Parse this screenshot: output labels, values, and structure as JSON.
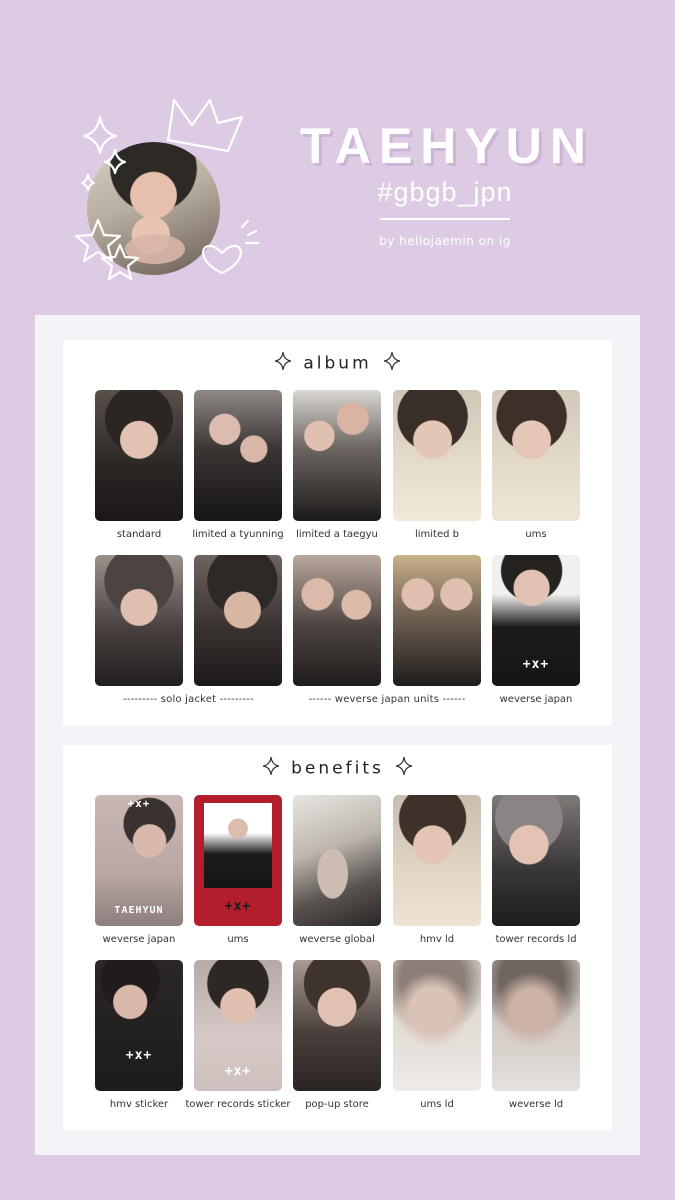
{
  "header": {
    "name": "TAEHYUN",
    "hashtag": "#gbgb_jpn",
    "credit": "by hellojaemin on ig"
  },
  "album": {
    "title": "album",
    "cards": [
      {
        "caption": "standard"
      },
      {
        "caption": "limited a tyunning"
      },
      {
        "caption": "limited a taegyu"
      },
      {
        "caption": "limited b"
      },
      {
        "caption": "ums"
      },
      {
        "caption": ""
      },
      {
        "caption": ""
      },
      {
        "caption": ""
      },
      {
        "caption": ""
      },
      {
        "caption": "weverse japan",
        "logo": "+x+"
      }
    ],
    "group_captions": {
      "solo_jacket": "--------- solo jacket ---------",
      "weverse_units": "------ weverse japan units ------"
    }
  },
  "benefits": {
    "title": "benefits",
    "cards": [
      {
        "caption": "weverse japan",
        "card_text": "TAEHYUN",
        "logo": "+x+"
      },
      {
        "caption": "ums",
        "logo": "+x+"
      },
      {
        "caption": "weverse global"
      },
      {
        "caption": "hmv ld"
      },
      {
        "caption": "tower records ld"
      },
      {
        "caption": "hmv sticker",
        "logo": "+x+"
      },
      {
        "caption": "tower records sticker",
        "logo": "+x+"
      },
      {
        "caption": "pop-up store"
      },
      {
        "caption": "ums ld"
      },
      {
        "caption": "weverse ld"
      }
    ]
  },
  "colors": {
    "background": "#ddcbe4",
    "panel": "#f6f3f8",
    "section": "#ffffff"
  }
}
